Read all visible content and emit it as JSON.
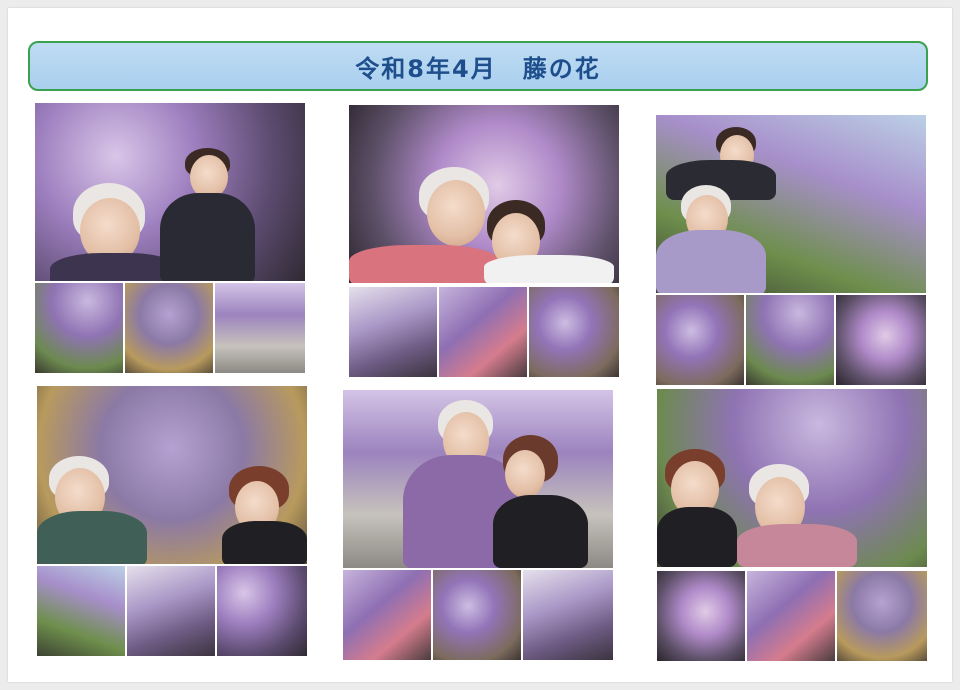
{
  "title": "令和8年4月　藤の花",
  "colors": {
    "banner_fill": "#b4d6f0",
    "banner_border": "#3aa24e",
    "title_text": "#1e4f8c"
  }
}
